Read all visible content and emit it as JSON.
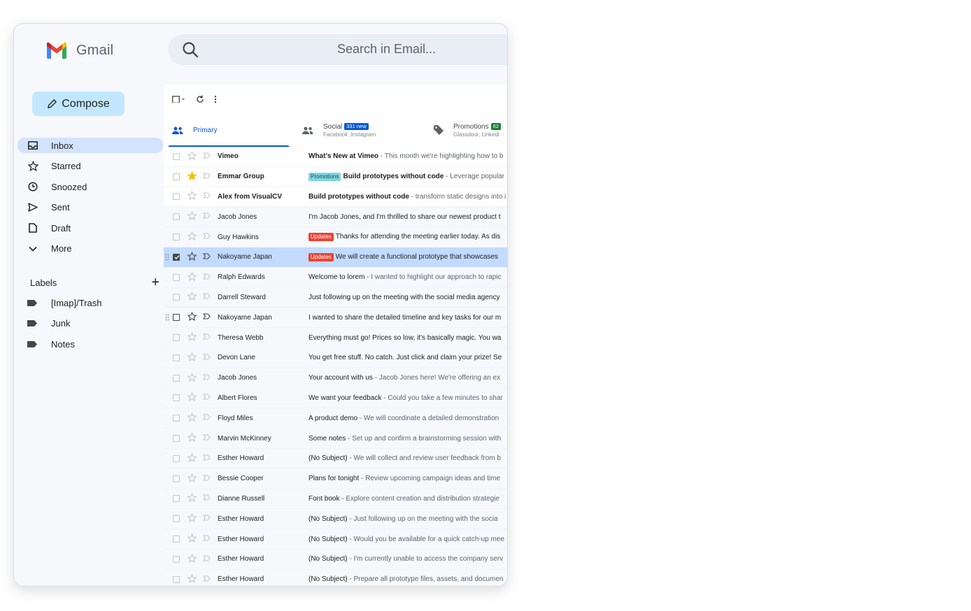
{
  "app": {
    "name": "Gmail"
  },
  "search": {
    "placeholder": "Search in Email..."
  },
  "compose": {
    "label": "Compose"
  },
  "nav": {
    "items": [
      {
        "label": "Inbox",
        "icon": "inbox-icon",
        "active": true
      },
      {
        "label": "Starred",
        "icon": "star-icon",
        "active": false
      },
      {
        "label": "Snoozed",
        "icon": "clock-icon",
        "active": false
      },
      {
        "label": "Sent",
        "icon": "send-icon",
        "active": false
      },
      {
        "label": "Draft",
        "icon": "draft-icon",
        "active": false
      },
      {
        "label": "More",
        "icon": "chevron-down-icon",
        "active": false
      }
    ]
  },
  "labels": {
    "heading": "Labels",
    "items": [
      {
        "label": "[Imap]/Trash"
      },
      {
        "label": "Junk"
      },
      {
        "label": "Notes"
      }
    ]
  },
  "tabs": {
    "primary": {
      "label": "Primary"
    },
    "social": {
      "label": "Social",
      "badge": "331 new",
      "sub": "Facebook ,Instagram",
      "badge_color": "#0b57d0"
    },
    "promotions": {
      "label": "Promotions",
      "badge": "62",
      "sub": "Glassdoor, Linkedi",
      "badge_color": "#188038"
    }
  },
  "colors": {
    "accent": "#0b57d0",
    "selected_row": "#c2dbff",
    "updates_tag": "#ea4335",
    "promotions_tag": "#7fd6e0",
    "star": "#fbbc04"
  },
  "emails": [
    {
      "sender": "Vimeo",
      "subject": "What's New at Vimeo",
      "snippet": " - This month we're highlighting how to b",
      "tag": "",
      "unread": true,
      "starred": false,
      "state": ""
    },
    {
      "sender": "Emmar Group",
      "subject": "Build prototypes without code",
      "snippet": " - Leverage popular",
      "tag": "Promotions",
      "unread": true,
      "starred": true,
      "state": ""
    },
    {
      "sender": "Alex from VisualCV",
      "subject": "Build prototypes without code",
      "snippet": " - transform static designs into i",
      "tag": "",
      "unread": true,
      "starred": false,
      "state": ""
    },
    {
      "sender": "Jacob Jones",
      "subject": "I'm Jacob Jones, and I'm thrilled to share our newest product t",
      "snippet": "",
      "tag": "",
      "unread": false,
      "starred": false,
      "state": ""
    },
    {
      "sender": "Guy Hawkins",
      "subject": "Thanks for attending the meeting earlier today. As dis",
      "snippet": "",
      "tag": "Updates",
      "unread": false,
      "starred": false,
      "state": ""
    },
    {
      "sender": "Nakoyame Japan",
      "subject": "We will create a functional prototype that showcases",
      "snippet": "",
      "tag": "Updates",
      "unread": false,
      "starred": false,
      "state": "selected"
    },
    {
      "sender": "Ralph Edwards",
      "subject": "Welcome to lorem",
      "snippet": " - I wanted to highlight our approach to rapic",
      "tag": "",
      "unread": false,
      "starred": false,
      "state": ""
    },
    {
      "sender": "Darrell Steward",
      "subject": "Just following up on the meeting with the social media agency",
      "snippet": "",
      "tag": "",
      "unread": false,
      "starred": false,
      "state": ""
    },
    {
      "sender": "Nakoyame Japan",
      "subject": "I wanted to share the detailed timeline and key tasks for our m",
      "snippet": "",
      "tag": "",
      "unread": false,
      "starred": false,
      "state": "hover"
    },
    {
      "sender": "Theresa Webb",
      "subject": "Everything must go! Prices so low, it's basically magic. You wa",
      "snippet": "",
      "tag": "",
      "unread": false,
      "starred": false,
      "state": ""
    },
    {
      "sender": "Devon Lane",
      "subject": "You get free stuff. No catch. Just click and claim your prize! Se",
      "snippet": "",
      "tag": "",
      "unread": false,
      "starred": false,
      "state": ""
    },
    {
      "sender": "Jacob Jones",
      "subject": "Your account with us",
      "snippet": " - Jacob Jones here! We're offering an ex",
      "tag": "",
      "unread": false,
      "starred": false,
      "state": ""
    },
    {
      "sender": "Albert Flores",
      "subject": "We want your feedback",
      "snippet": " - Could you take a few minutes to shar",
      "tag": "",
      "unread": false,
      "starred": false,
      "state": ""
    },
    {
      "sender": "Floyd Miles",
      "subject": "A product demo",
      "snippet": " - We will coordinate a detailed demonstration",
      "tag": "",
      "unread": false,
      "starred": false,
      "state": ""
    },
    {
      "sender": "Marvin McKinney",
      "subject": "Some notes",
      "snippet": " - Set up and confirm a brainstorming session with",
      "tag": "",
      "unread": false,
      "starred": false,
      "state": ""
    },
    {
      "sender": "Esther Howard",
      "subject": "(No Subject)",
      "snippet": " - We will collect and review user feedback from b",
      "tag": "",
      "unread": false,
      "starred": false,
      "state": ""
    },
    {
      "sender": "Bessie Cooper",
      "subject": "Plans for tonight",
      "snippet": " - Review upcoming campaign ideas and time",
      "tag": "",
      "unread": false,
      "starred": false,
      "state": ""
    },
    {
      "sender": "Dianne Russell",
      "subject": "Font book",
      "snippet": " - Explore content creation and distribution strategie",
      "tag": "",
      "unread": false,
      "starred": false,
      "state": ""
    },
    {
      "sender": "Esther Howard",
      "subject": "(No Subject)",
      "snippet": " - Just following up on the meeting with the socia",
      "tag": "",
      "unread": false,
      "starred": false,
      "state": ""
    },
    {
      "sender": "Esther Howard",
      "subject": "(No Subject)",
      "snippet": " - Would you be available for a quick catch-up mee",
      "tag": "",
      "unread": false,
      "starred": false,
      "state": ""
    },
    {
      "sender": "Esther Howard",
      "subject": "(No Subject)",
      "snippet": " - I'm currently unable to access the company serv",
      "tag": "",
      "unread": false,
      "starred": false,
      "state": ""
    },
    {
      "sender": "Esther Howard",
      "subject": "(No Subject)",
      "snippet": " - Prepare all prototype files, assets, and documen",
      "tag": "",
      "unread": false,
      "starred": false,
      "state": ""
    }
  ]
}
